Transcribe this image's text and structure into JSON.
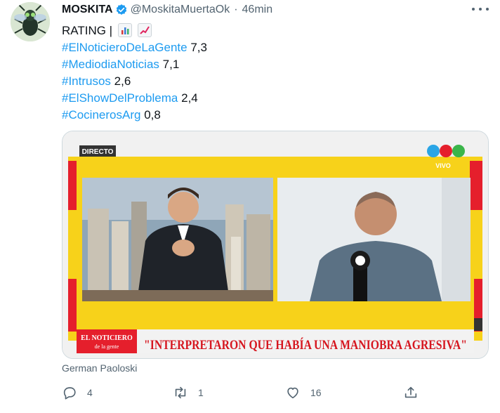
{
  "author": {
    "name": "MOSKITA",
    "handle": "@MoskitaMuertaOk",
    "separator": "·",
    "time": "46min"
  },
  "icons": {
    "avatar": "mosquito-avatar",
    "verified": "verified-badge-icon",
    "more": "more-options-icon",
    "reply": "reply-icon",
    "retweet": "retweet-icon",
    "like": "like-icon",
    "share": "share-icon",
    "emoji1": "bar-chart-emoji",
    "emoji2": "chart-increasing-emoji"
  },
  "tweet": {
    "rating_label": "RATING |",
    "items": [
      {
        "hashtag": "#ElNoticieroDeLaGente",
        "value": "7,3"
      },
      {
        "hashtag": "#MediodiaNoticias",
        "value": "7,1"
      },
      {
        "hashtag": "#Intrusos",
        "value": "2,6"
      },
      {
        "hashtag": "#ElShowDelProblema",
        "value": "2,4"
      },
      {
        "hashtag": "#CocinerosArg",
        "value": "0,8"
      }
    ]
  },
  "media": {
    "live_badge": "DIRECTO",
    "channel_label": "VIVO",
    "show_logo_line1": "EL NOTICIERO",
    "show_logo_line2": "de la gente",
    "headline": "\"INTERPRETARON QUE HABÍA UNA MANIOBRA AGRESIVA\""
  },
  "caption": "German Paoloski",
  "actions": {
    "replies": "4",
    "retweets": "1",
    "likes": "16"
  },
  "colors": {
    "accent": "#1d9bf0",
    "secondary_text": "#536471",
    "banner_yellow": "#f7d21a",
    "banner_red": "#e51f2c"
  }
}
